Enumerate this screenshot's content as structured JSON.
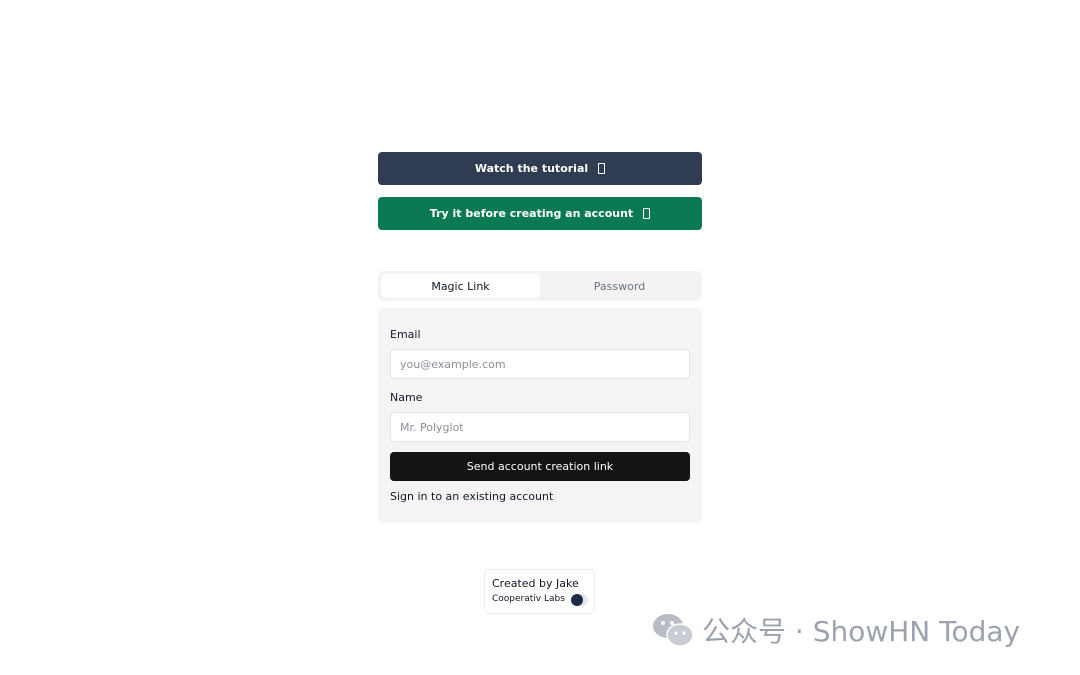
{
  "actions": {
    "tutorial_label": "Watch the tutorial",
    "try_label": "Try it before creating an account"
  },
  "tabs": [
    {
      "label": "Magic Link",
      "active": true
    },
    {
      "label": "Password",
      "active": false
    }
  ],
  "form": {
    "email_label": "Email",
    "email_placeholder": "you@example.com",
    "email_value": "",
    "name_label": "Name",
    "name_placeholder": "Mr. Polyglot",
    "name_value": "",
    "submit_label": "Send account creation link",
    "signin_link": "Sign in to an existing account"
  },
  "credit": {
    "title": "Created by Jake",
    "org": "Cooperativ Labs"
  },
  "watermark": {
    "text": "公众号 · ShowHN Today"
  },
  "colors": {
    "tutorial_button": "#2f3c52",
    "try_button": "#0b7a52",
    "submit_button": "#141416",
    "card_background": "#f4f4f5"
  },
  "icons": {
    "tutorial_icon": "external-link-icon",
    "try_icon": "external-link-icon",
    "theme_toggle": "theme-toggle-icon",
    "watermark_logo": "wechat-icon"
  }
}
